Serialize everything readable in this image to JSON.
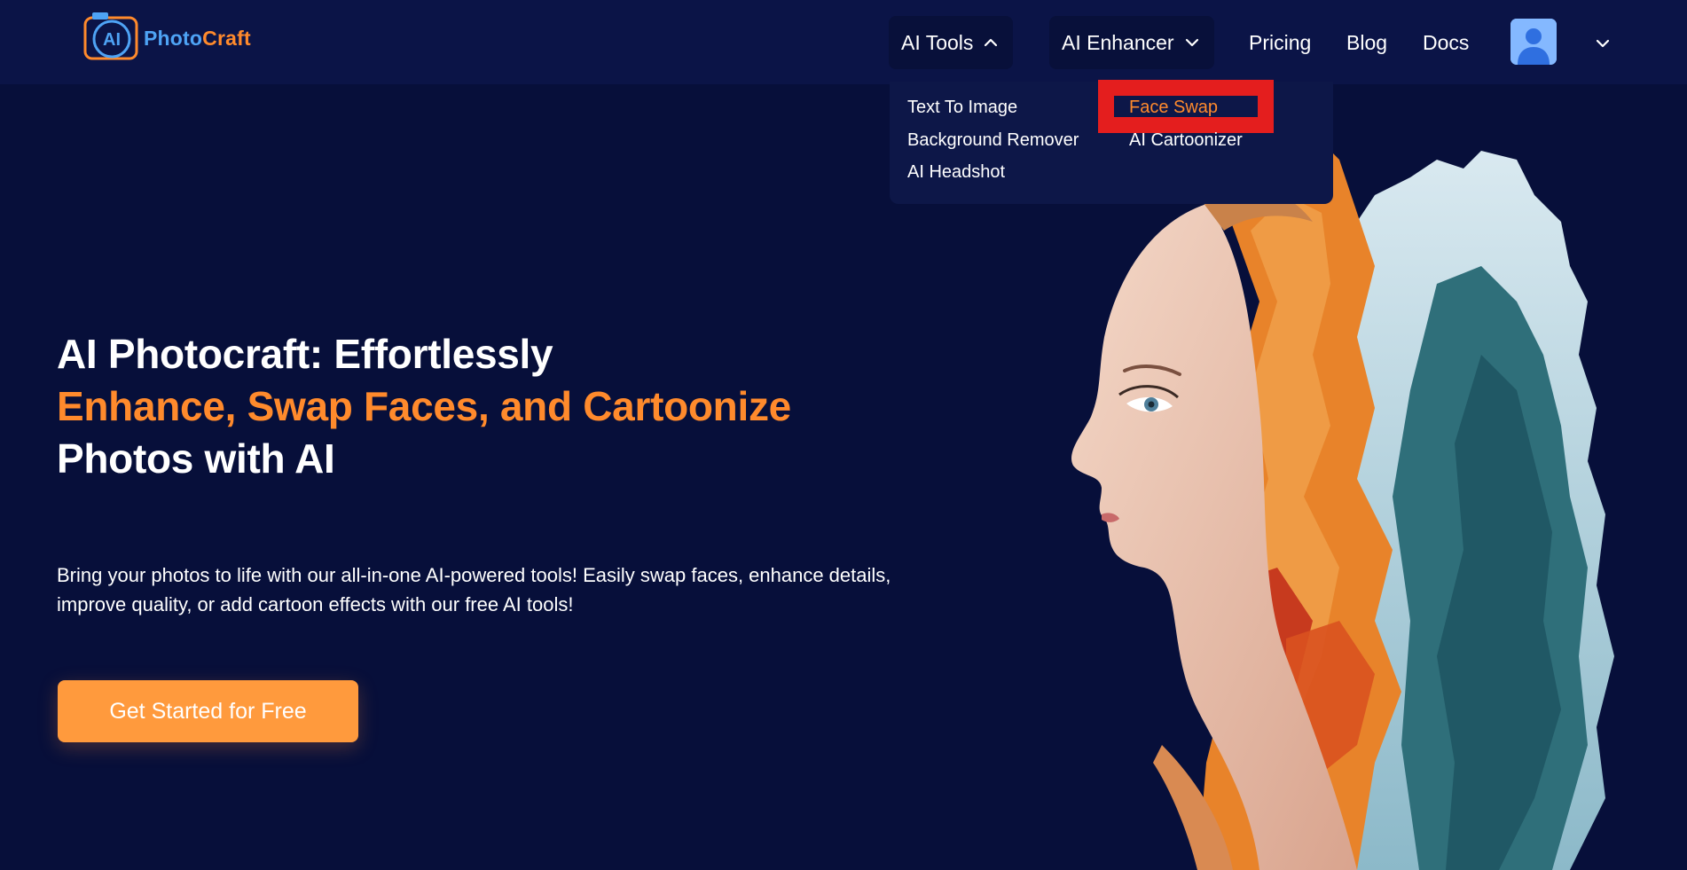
{
  "brand": {
    "logo_mark": "AI",
    "name_part1": "Photo",
    "name_part2": "Craft"
  },
  "nav": {
    "ai_tools": "AI Tools",
    "ai_enhancer": "AI Enhancer",
    "pricing": "Pricing",
    "blog": "Blog",
    "docs": "Docs"
  },
  "dropdown": {
    "text_to_image": "Text To Image",
    "face_swap": "Face Swap",
    "background_remover": "Background Remover",
    "ai_cartoonizer": "AI Cartoonizer",
    "ai_headshot": "AI Headshot"
  },
  "hero": {
    "title_line1": "AI Photocraft: Effortlessly",
    "title_line2": "Enhance, Swap Faces, and Cartoonize",
    "title_line3": "Photos with AI",
    "description": "Bring your photos to life with our all-in-one AI-powered tools! Easily swap faces, enhance details, improve quality, or add cartoon effects with our free AI tools!",
    "cta": "Get Started for Free"
  },
  "colors": {
    "background": "#070f3a",
    "header": "#0b1447",
    "accent_orange": "#ff8a2c",
    "cta": "#ff9a3d",
    "highlight_box": "#e41e1e"
  },
  "icons": [
    "chevron-up-icon",
    "chevron-down-icon",
    "user-avatar-icon"
  ]
}
